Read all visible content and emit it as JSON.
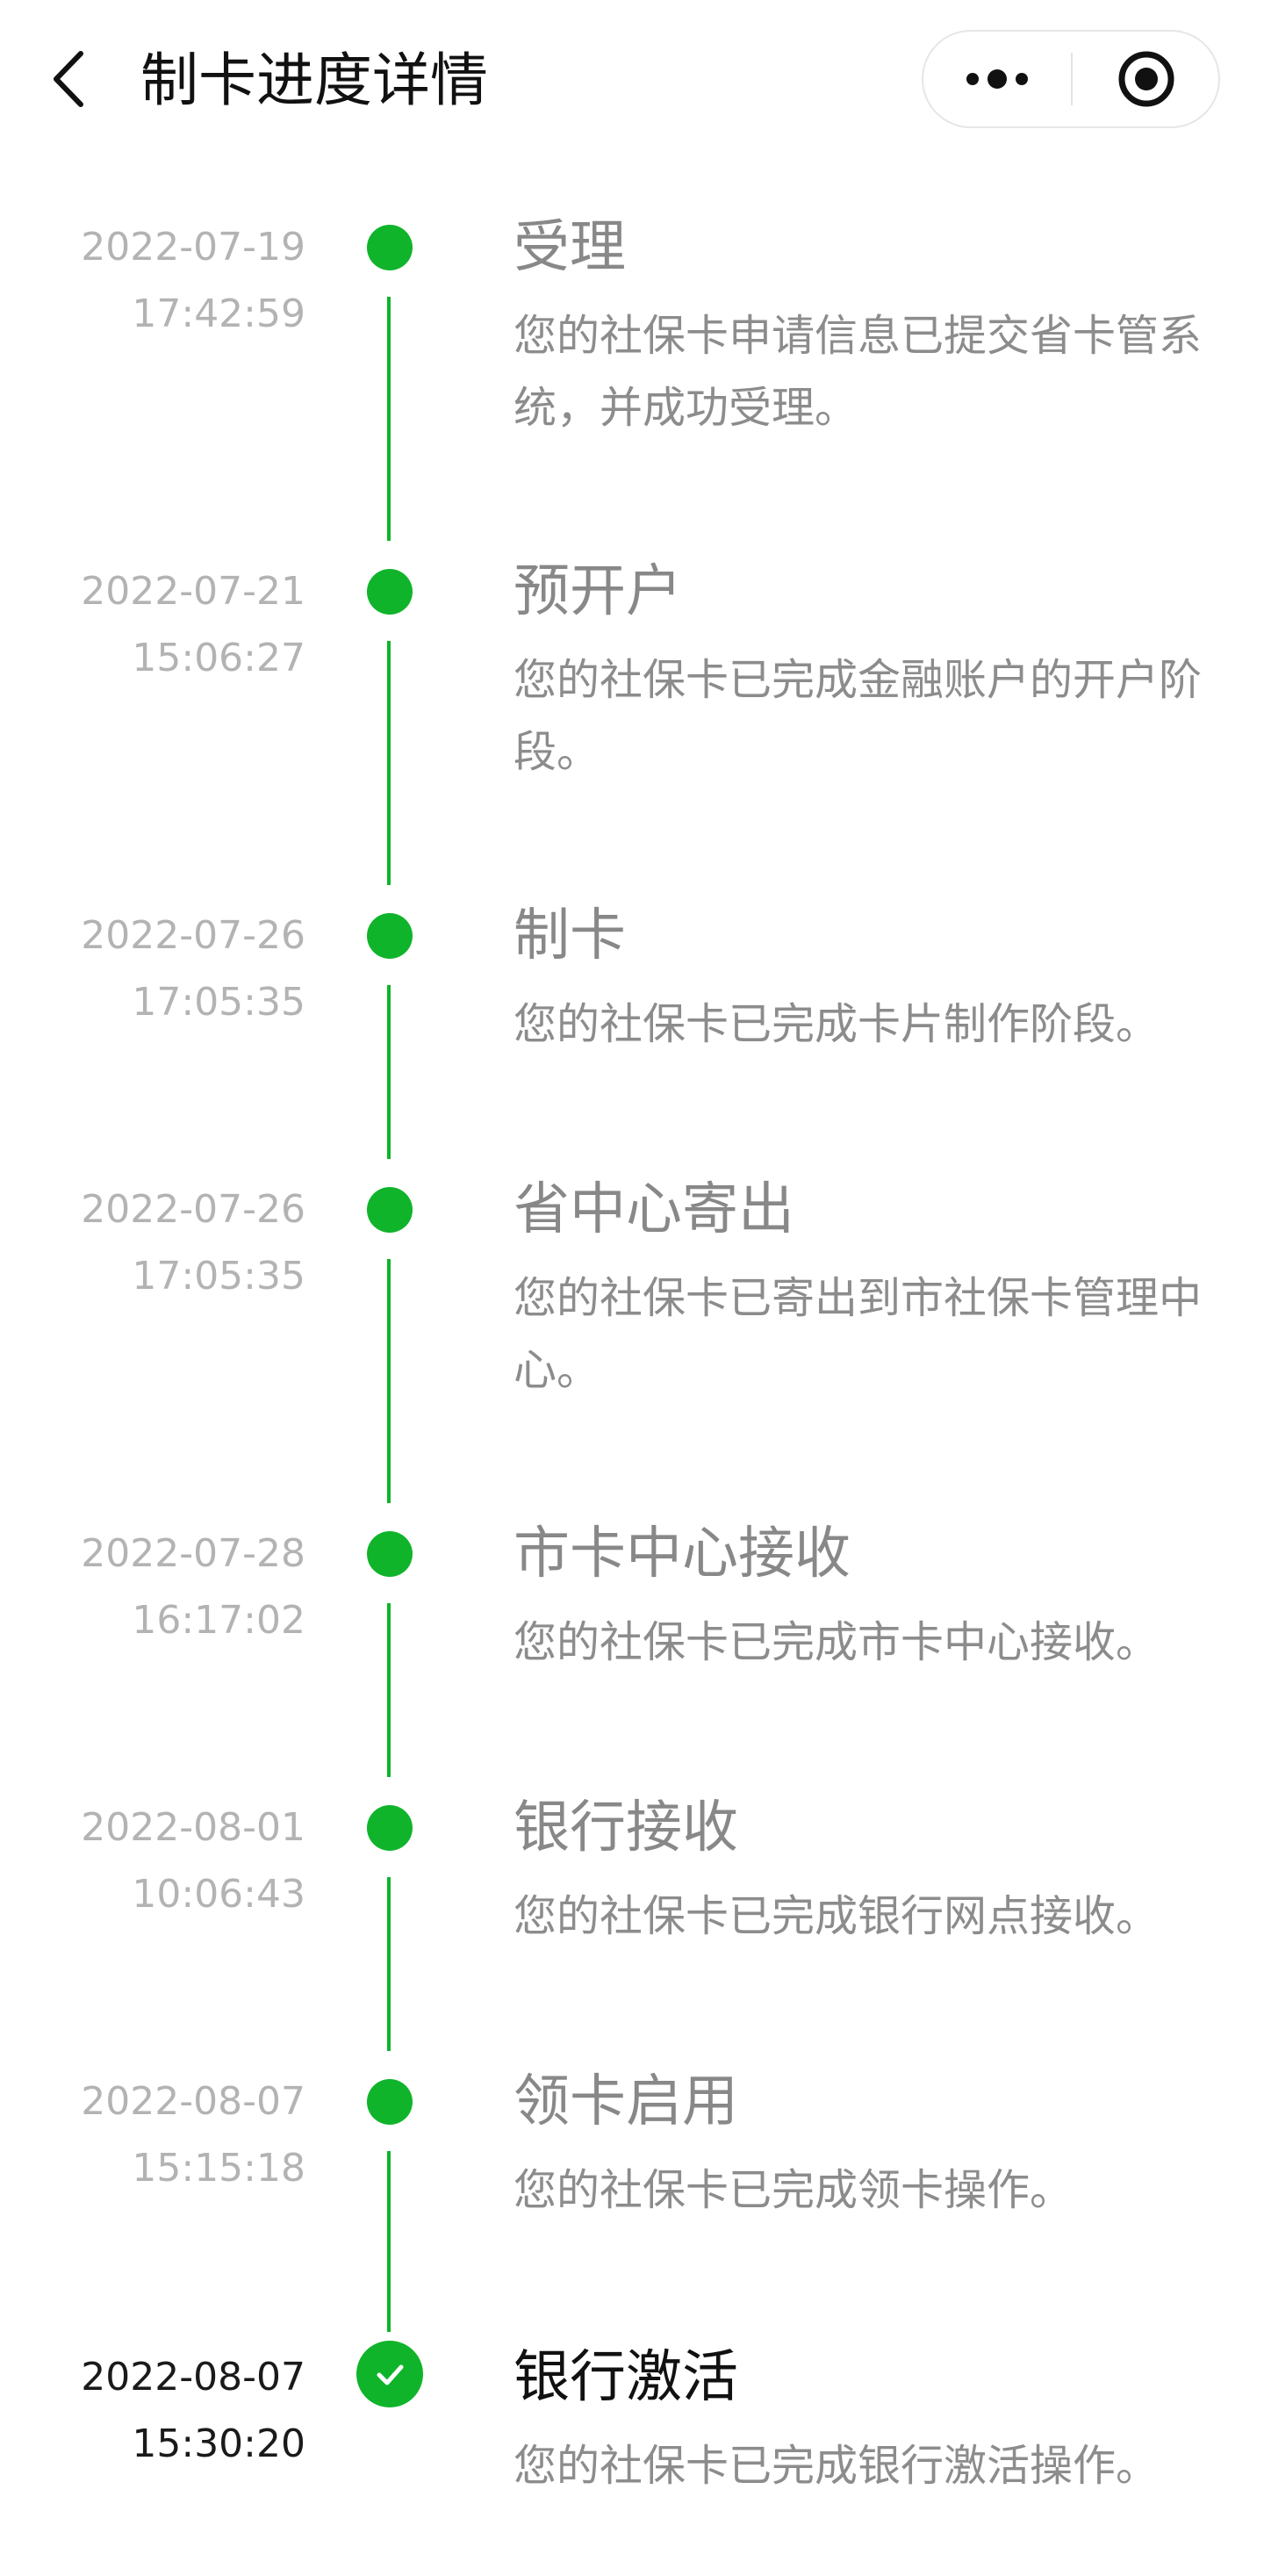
{
  "header": {
    "title": "制卡进度详情",
    "back_icon": "chevron-left-icon",
    "more_icon": "more-dots-icon",
    "close_icon": "target-close-icon"
  },
  "colors": {
    "accent": "#0fb42a",
    "text_primary": "#111111",
    "text_secondary": "#8c8c8c",
    "text_muted": "#b3b3b3"
  },
  "steps": [
    {
      "date": "2022-07-19",
      "time": "17:42:59",
      "title": "受理",
      "description": "您的社保卡申请信息已提交省卡管系统，并成功受理。",
      "status": "done"
    },
    {
      "date": "2022-07-21",
      "time": "15:06:27",
      "title": "预开户",
      "description": "您的社保卡已完成金融账户的开户阶段。",
      "status": "done"
    },
    {
      "date": "2022-07-26",
      "time": "17:05:35",
      "title": "制卡",
      "description": "您的社保卡已完成卡片制作阶段。",
      "status": "done"
    },
    {
      "date": "2022-07-26",
      "time": "17:05:35",
      "title": "省中心寄出",
      "description": "您的社保卡已寄出到市社保卡管理中心。",
      "status": "done"
    },
    {
      "date": "2022-07-28",
      "time": "16:17:02",
      "title": "市卡中心接收",
      "description": "您的社保卡已完成市卡中心接收。",
      "status": "done"
    },
    {
      "date": "2022-08-01",
      "time": "10:06:43",
      "title": "银行接收",
      "description": "您的社保卡已完成银行网点接收。",
      "status": "done"
    },
    {
      "date": "2022-08-07",
      "time": "15:15:18",
      "title": "领卡启用",
      "description": "您的社保卡已完成领卡操作。",
      "status": "done"
    },
    {
      "date": "2022-08-07",
      "time": "15:30:20",
      "title": "银行激活",
      "description": "您的社保卡已完成银行激活操作。",
      "status": "current"
    }
  ]
}
